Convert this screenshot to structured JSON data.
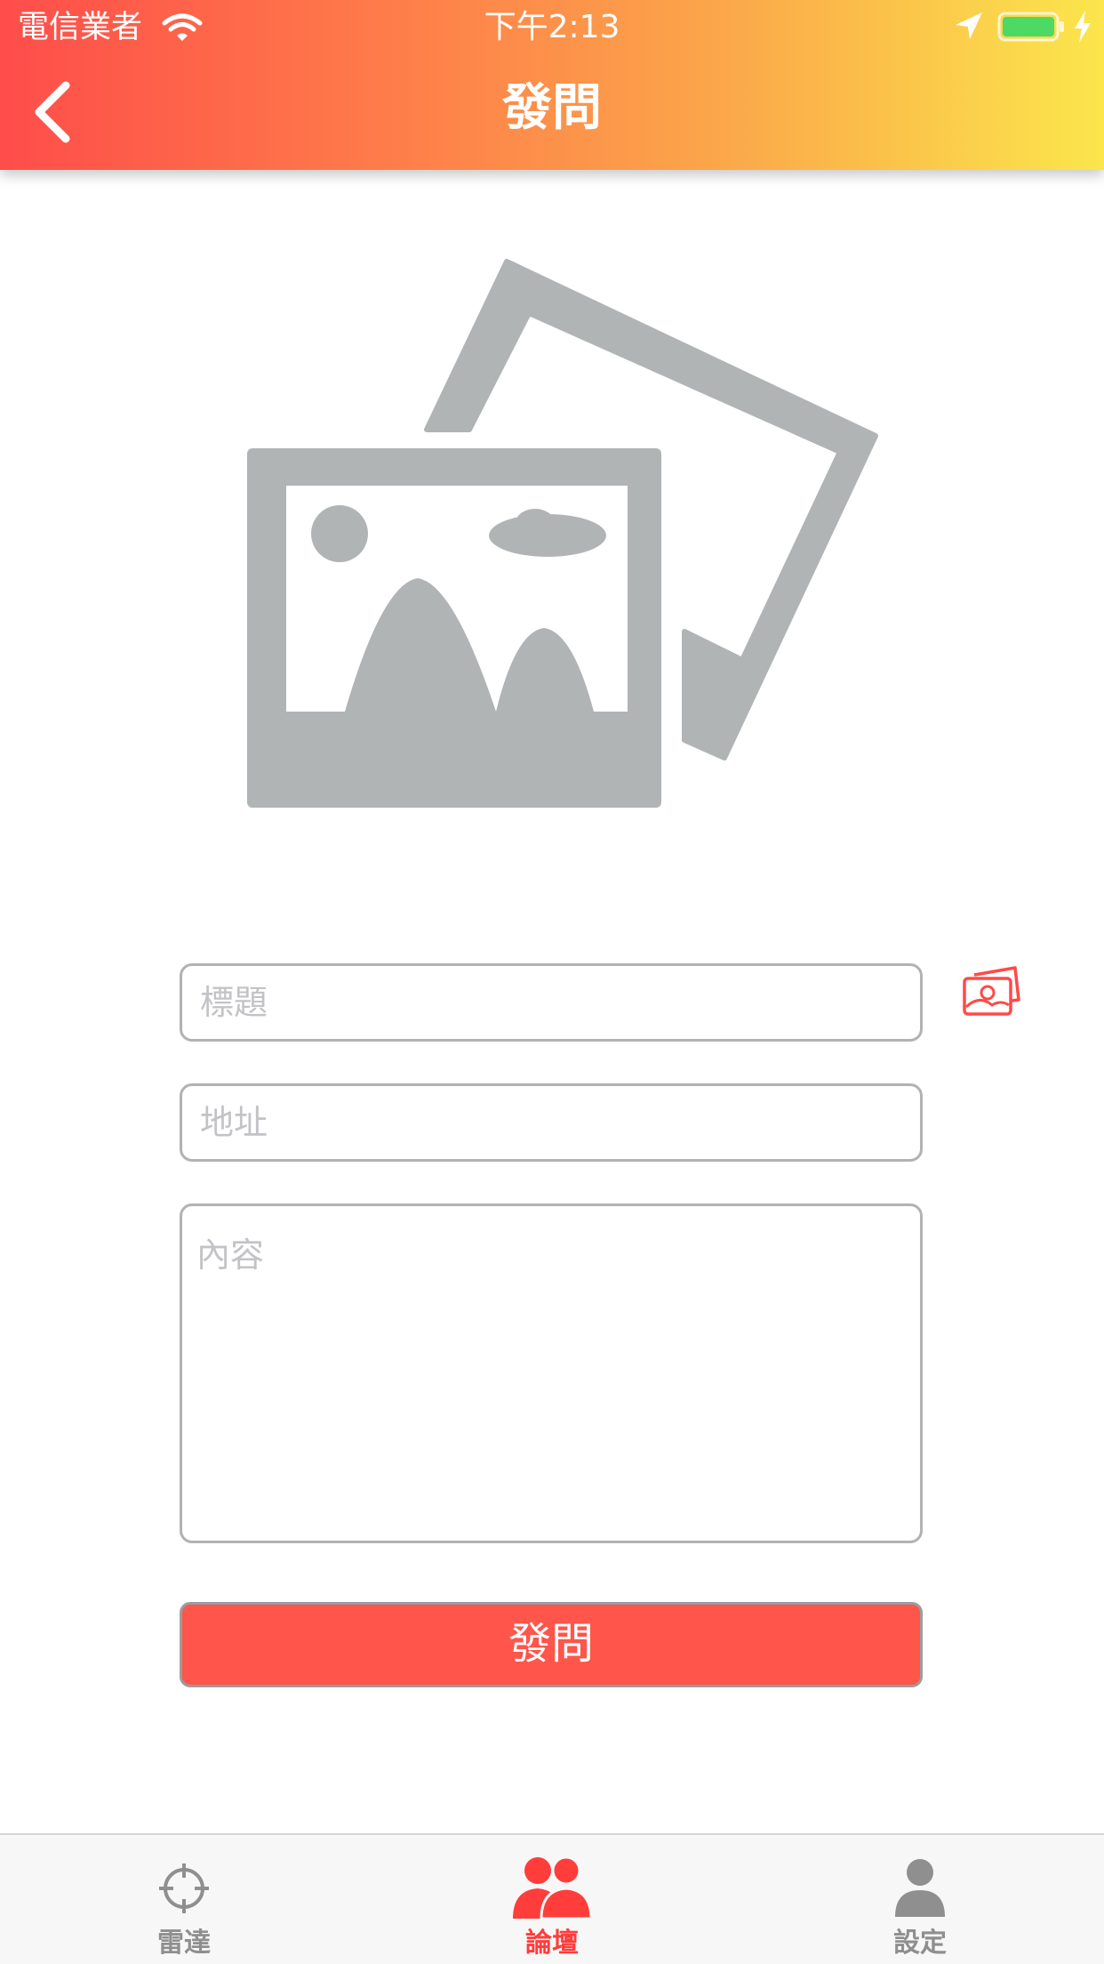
{
  "status_bar": {
    "carrier": "電信業者",
    "time": "下午2:13",
    "battery_color": "#4cd964"
  },
  "nav": {
    "title": "發問",
    "back_icon": "chevron-left-icon"
  },
  "placeholder_image": {
    "icon": "photo-placeholder-icon",
    "color": "#b1b4b5"
  },
  "form": {
    "title_placeholder": "標題",
    "title_value": "",
    "address_placeholder": "地址",
    "address_value": "",
    "content_placeholder": "內容",
    "content_value": "",
    "gallery_icon": "image-gallery-icon",
    "submit_label": "發問"
  },
  "colors": {
    "accent": "#ff554b",
    "tab_active": "#ff3d3b",
    "tab_inactive": "#8f8f8f",
    "header_gradient": [
      "#fe4d4a",
      "#fbe64b"
    ]
  },
  "tabbar": {
    "tabs": [
      {
        "label": "雷達",
        "icon": "crosshair-icon",
        "active": false
      },
      {
        "label": "論壇",
        "icon": "users-icon",
        "active": true
      },
      {
        "label": "設定",
        "icon": "person-icon",
        "active": false
      }
    ]
  }
}
